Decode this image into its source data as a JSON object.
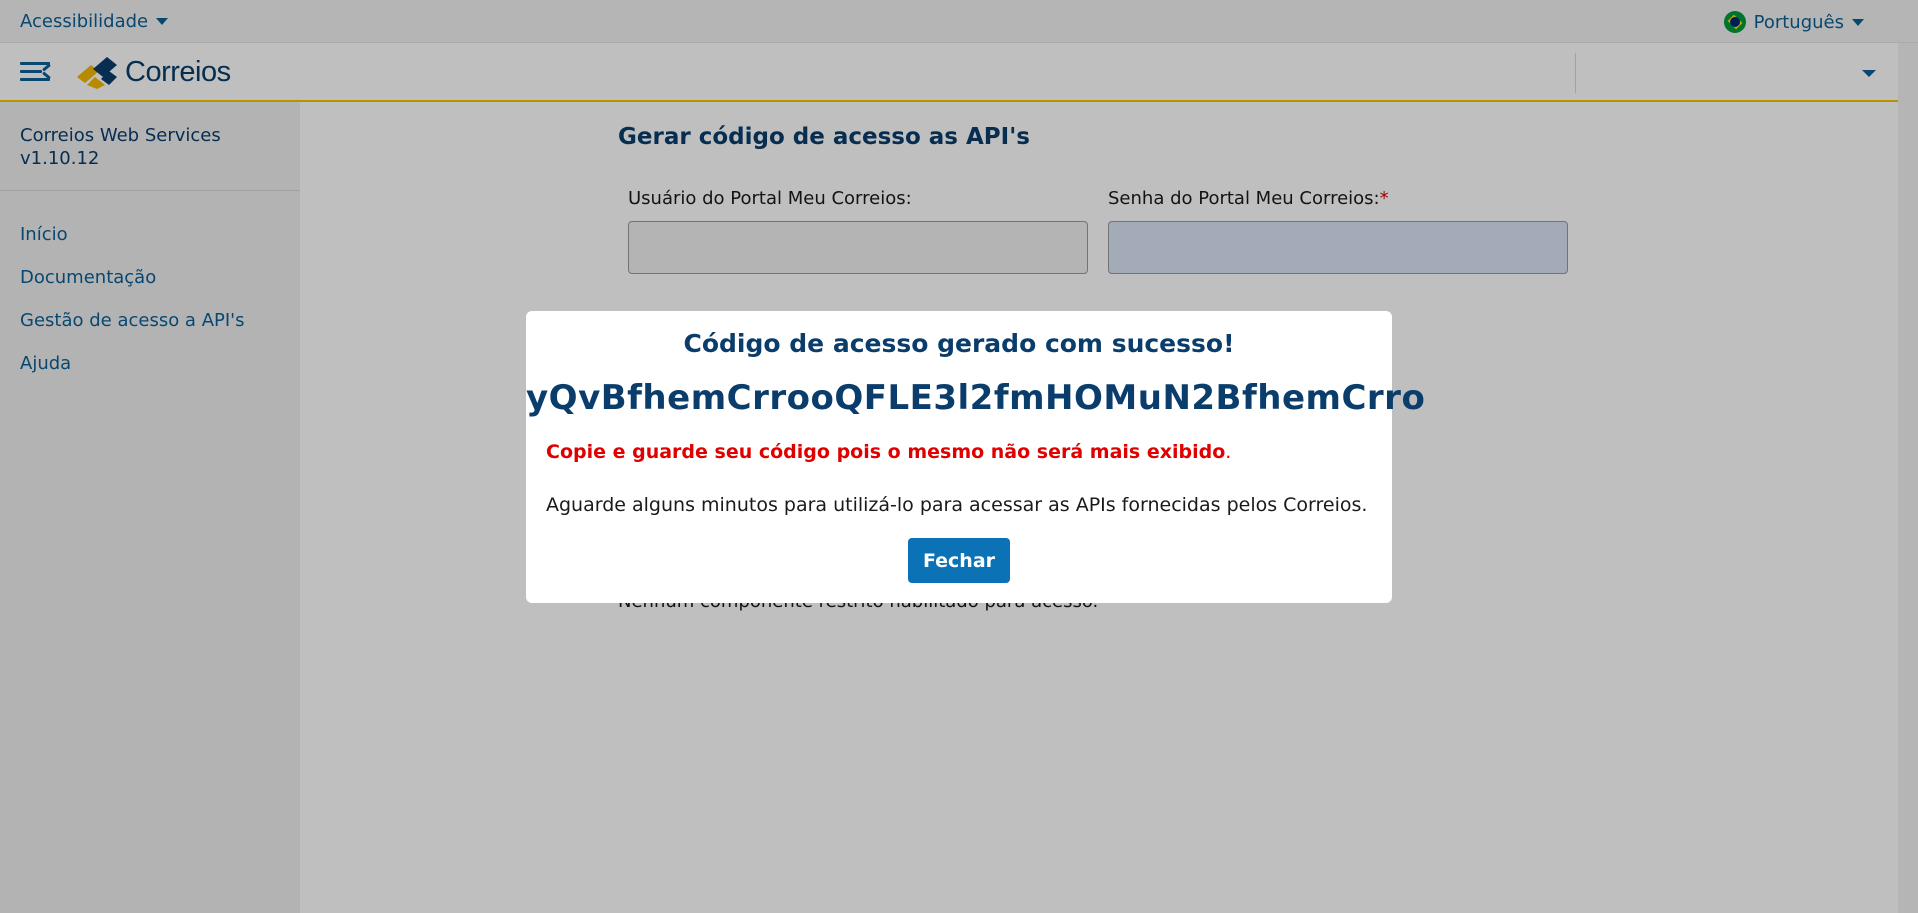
{
  "topbar": {
    "accessibility_label": "Acessibilidade",
    "language_label": "Português"
  },
  "header": {
    "logo_text": "Correios"
  },
  "sidebar": {
    "title": "Correios Web Services",
    "version": "v1.10.12",
    "items": [
      {
        "label": "Início"
      },
      {
        "label": "Documentação"
      },
      {
        "label": "Gestão de acesso a API's"
      },
      {
        "label": "Ajuda"
      }
    ]
  },
  "main": {
    "title": "Gerar código de acesso as API's",
    "user_label": "Usuário do Portal Meu Correios:",
    "user_value": "",
    "password_label": "Senha do Portal Meu Correios:",
    "password_required_mark": "*",
    "password_value": "",
    "partial_text": "Nenhum componente restrito habilitado para acesso."
  },
  "modal": {
    "title": "Código de acesso gerado com sucesso!",
    "code": "yQvBfhemCrrooQFLE3l2fmHOMuN2BfhemCrro",
    "warning": "Copie e guarde seu código pois o mesmo não será mais exibido",
    "warning_period": ".",
    "info": "Aguarde alguns minutos para utilizá-lo para acessar as APIs fornecidas pelos Correios.",
    "close_label": "Fechar"
  },
  "colors": {
    "brand_blue": "#0a3d6b",
    "link_blue": "#0b5f96",
    "button_blue": "#0b72b5",
    "accent_yellow": "#f5c400",
    "warning_red": "#e00000"
  }
}
